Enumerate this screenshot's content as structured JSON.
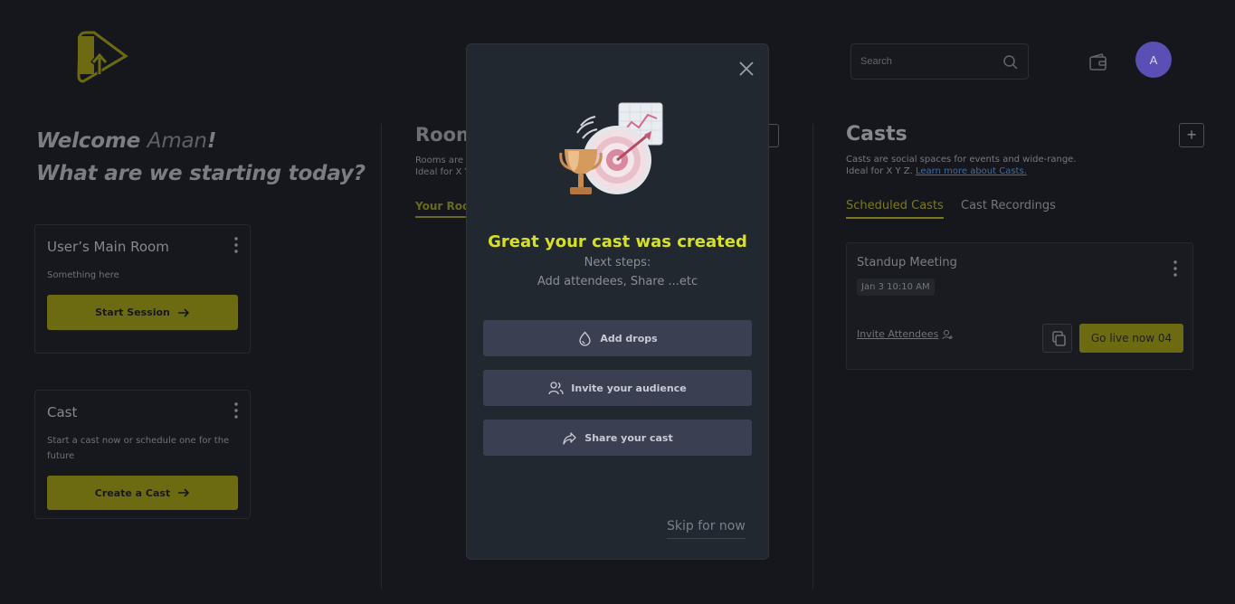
{
  "header": {
    "search_placeholder": "Search",
    "avatar_initial": "A"
  },
  "welcome": {
    "greeting": "Welcome ",
    "name": "Aman",
    "exclaim": "!",
    "question": "What are we starting today?"
  },
  "cards": {
    "main_room": {
      "title": "User’s Main Room",
      "desc": "Something here",
      "button": "Start Session"
    },
    "cast": {
      "title": "Cast",
      "desc": "Start a cast now or schedule one for the future",
      "button": "Create a Cast"
    }
  },
  "rooms": {
    "title": "Rooms",
    "desc_line1": "Rooms are",
    "desc_line2": "Ideal for X Y",
    "tab": "Your Rooms"
  },
  "casts": {
    "title": "Casts",
    "desc_line1": "Casts are social spaces for events and wide-range.",
    "desc_line2": "Ideal for X Y Z. ",
    "learn_more": "Learn more about Casts.",
    "add": "+",
    "tabs": [
      "Scheduled Casts",
      "Cast Recordings"
    ],
    "meeting": {
      "title": "Standup Meeting",
      "date": "Jan 3 10:10 AM",
      "invite": "Invite Attendees",
      "go_live": "Go live now 04"
    }
  },
  "modal": {
    "headline": "Great your cast was created",
    "next_steps": "Next steps:",
    "next_steps_detail": "Add attendees, Share ...etc",
    "actions": [
      "Add drops",
      "Invite your audience",
      "Share your cast"
    ],
    "skip": "Skip for now"
  },
  "colors": {
    "accent": "#d7e024",
    "button_dim": "#6d6b12",
    "avatar": "#5a4fb5",
    "modal_bg": "#212830",
    "action_bg": "#3a4052"
  },
  "icons": [
    "logo-icon",
    "search-icon",
    "wallet-icon",
    "kebab-icon",
    "arrow-right-icon",
    "close-icon",
    "drop-icon",
    "users-icon",
    "share-icon",
    "copy-icon",
    "add-user-icon",
    "trophy-target-illustration"
  ]
}
